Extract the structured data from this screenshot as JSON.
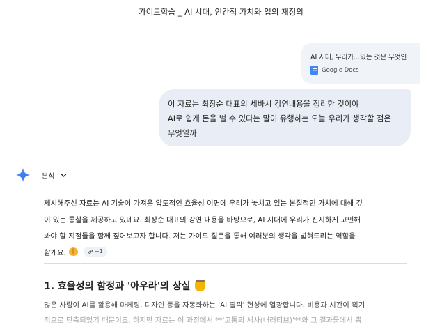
{
  "conversation": {
    "title": "가이드학습 _ AI 시대, 인간적 가치와 업의 재정의"
  },
  "attachment": {
    "name": "AI 시대, 우리가...있는 것은 무엇인",
    "source_label": "Google Docs",
    "icon": "google-docs-icon"
  },
  "user_message": {
    "lines": [
      "이 자료는 최장순 대표의 세바시 강연내용을 정리한 것이야",
      "AI로 쉽게 돈을 벌 수 있다는 말이 유행하는 오늘 우리가 생각할 점은",
      "무엇일까"
    ]
  },
  "response": {
    "analysis_label": "분석",
    "intro_lines": [
      "제시해주신 자료는 AI 기술이 가져온 압도적인 효율성 이면에 우리가 놓치고 있는 본질적인 가치에 대해 깊",
      "이 있는 통찰을 제공하고 있네요.  최장순 대표의 강연 내용을 바탕으로, AI 시대에 우리가 진지하게 고민해",
      "봐야 할 지점들을 함께 짚어보고자 합니다. 저는 가이드 질문을 통해 여러분의 생각을 넓혀드리는 역할을",
      "할게요."
    ],
    "source_chip": "+1",
    "section_heading": "1. 효율성의 함정과 '아우라'의 상실",
    "body_lines": [
      "많은 사람이 AI를 활용해 마케팅, 디자인 등을 자동화하는 'AI 딸깍' 현상에 열광합니다. 비용과 시간이 획기",
      "적으로 단축되었기 때문이죠. 하지만 자료는 이 과정에서 **'고통의 서사(내러티브)'**와 그 결과물에서 뿜"
    ]
  },
  "colors": {
    "user_bubble": "#e9eef6",
    "attachment_card": "#f0f4f9",
    "gemini_blue": "#3b82f6",
    "docs_blue": "#4285f4"
  }
}
